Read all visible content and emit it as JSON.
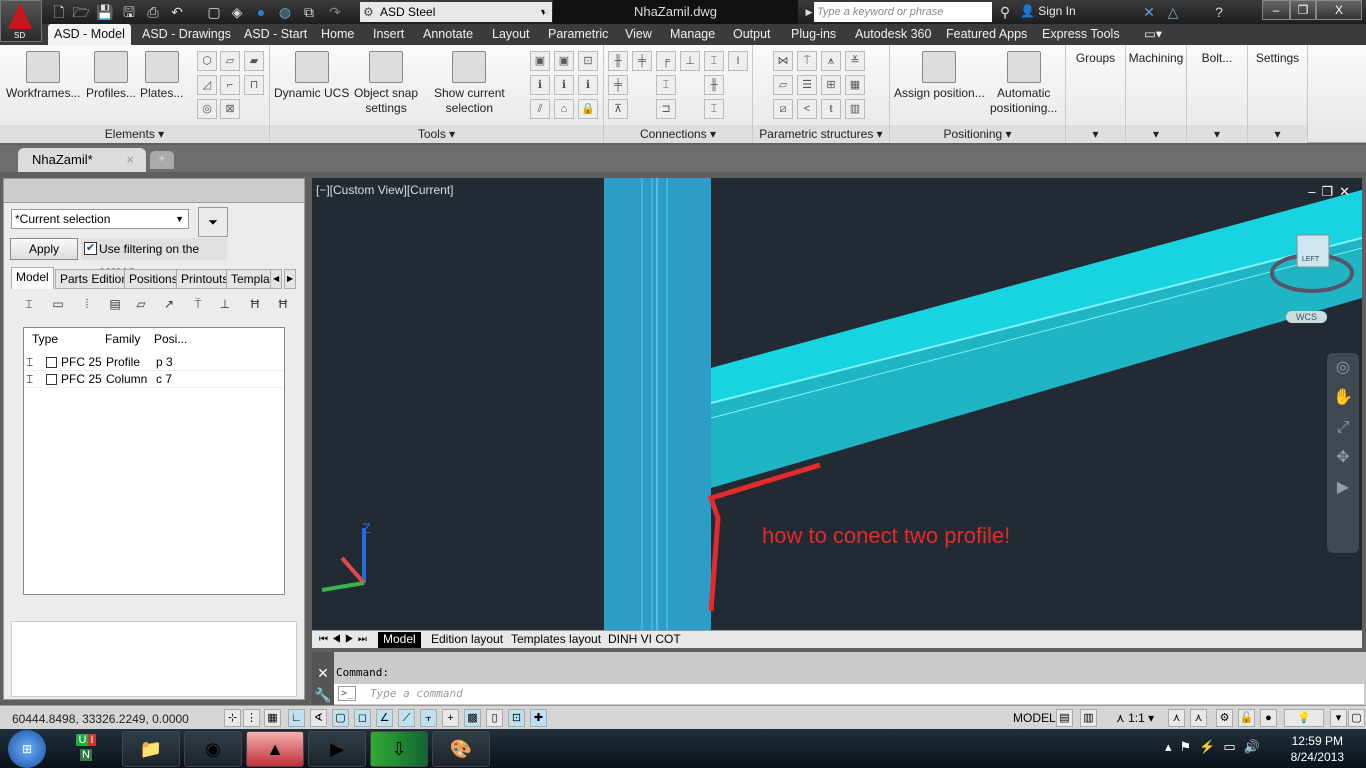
{
  "title_bar": {
    "app_badge": "SD",
    "workspace": "ASD Steel",
    "filename": "NhaZamil.dwg",
    "search_placeholder": "Type a keyword or phrase",
    "sign_in": "Sign In",
    "minimize": "–",
    "restore": "❐",
    "close": "X"
  },
  "ribbon_tabs": [
    "ASD - Model",
    "ASD - Drawings",
    "ASD - Start",
    "Home",
    "Insert",
    "Annotate",
    "Layout",
    "Parametric",
    "View",
    "Manage",
    "Output",
    "Plug-ins",
    "Autodesk 360",
    "Featured Apps",
    "Express Tools"
  ],
  "active_ribbon_tab": "ASD - Model",
  "ribbon": {
    "elements": {
      "title": "Elements ▾",
      "workframes": "Workframes...",
      "profiles": "Profiles...",
      "plates": "Plates..."
    },
    "tools": {
      "title": "Tools ▾",
      "dynamic_ucs": "Dynamic UCS",
      "object_snap_1": "Object snap",
      "object_snap_2": "settings",
      "show_current_1": "Show current",
      "show_current_2": "selection"
    },
    "connections": {
      "title": "Connections ▾"
    },
    "parametric": {
      "title": "Parametric structures ▾"
    },
    "positioning": {
      "title": "Positioning ▾",
      "assign": "Assign position...",
      "auto_1": "Automatic",
      "auto_2": "positioning..."
    },
    "groups": "Groups",
    "machining": "Machining",
    "bolt": "Bolt...",
    "settings": "Settings"
  },
  "document_tab": {
    "label": "NhaZamil*",
    "close": "×"
  },
  "left_panel": {
    "selection": "*Current selection",
    "apply": "Apply",
    "use_filtering": "Use filtering on the screen",
    "use_filtering_checked": true,
    "tabs": [
      "Model",
      "Parts Edition",
      "Positions",
      "Printouts",
      "Templa"
    ],
    "active_tab": "Model",
    "columns": [
      "Type",
      "Family",
      "Posi..."
    ],
    "rows": [
      {
        "type": "PFC 25",
        "family": "Profile",
        "position": "p 3"
      },
      {
        "type": "PFC 25",
        "family": "Column",
        "position": "c 7"
      }
    ]
  },
  "viewport": {
    "label": "[−][Custom View][Current]",
    "annotation": "how to conect two profile!",
    "annotation_color": "#e42a2a",
    "viewcube_face": "LEFT",
    "wcs": "WCS",
    "axis_z": "Z"
  },
  "layout_tabs": [
    "Model",
    "Edition layout",
    "Templates layout",
    "DINH VI COT"
  ],
  "command": {
    "label": "Command:",
    "placeholder": "Type a command"
  },
  "status": {
    "coordinates": "60444.8498, 33326.2249, 0.0000",
    "model": "MODEL",
    "scale": "1:1 ▾"
  },
  "taskbar": {
    "time": "12:59 PM",
    "date": "8/24/2013"
  }
}
